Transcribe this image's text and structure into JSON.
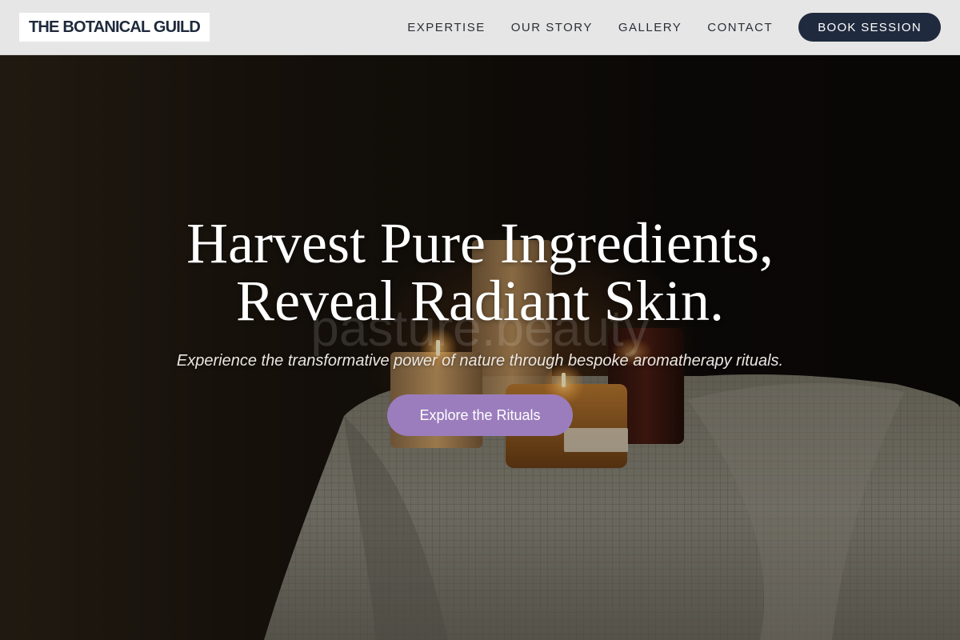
{
  "brand": {
    "name": "THE BOTANICAL GUILD"
  },
  "nav": {
    "links": [
      "EXPERTISE",
      "OUR STORY",
      "GALLERY",
      "CONTACT"
    ],
    "cta_label": "BOOK SESSION"
  },
  "hero": {
    "headline_line1": "Harvest Pure Ingredients,",
    "headline_line2": "Reveal Radiant Skin.",
    "subtitle": "Experience the transformative power of nature through bespoke aromatherapy rituals.",
    "cta_label": "Explore the Rituals",
    "watermark_text": "pasture.beauty",
    "background_image": "candles-on-white-waffle-towel"
  },
  "colors": {
    "nav_bg": "#e6e6e6",
    "brand_text": "#1e2a3c",
    "book_button_bg": "#1f2a3e",
    "cta_purple": "#9b7dbd",
    "hero_text": "#ffffff"
  },
  "icons": {}
}
